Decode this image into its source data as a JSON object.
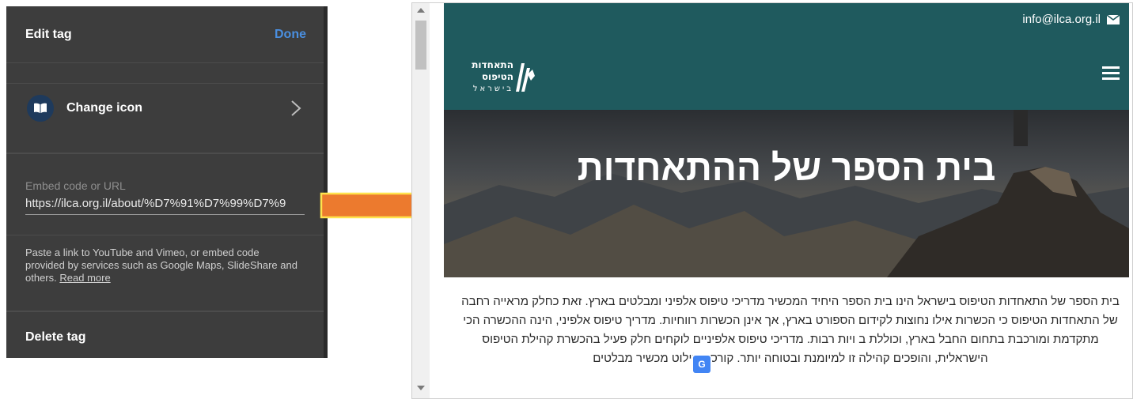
{
  "editor": {
    "header_title": "Edit tag",
    "done_label": "Done",
    "change_icon_label": "Change icon",
    "embed_label": "Embed code or URL",
    "embed_value": "https://ilca.org.il/about/%D7%91%D7%99%D7%9",
    "help_text": "Paste a link to YouTube and Vimeo, or embed code provided by services such as Google Maps, SlideShare and others.",
    "read_more": "Read more",
    "delete_label": "Delete tag",
    "accent_color": "#4a8fe0"
  },
  "site": {
    "email": "info@ilca.org.il",
    "brand_color": "#1f5a5e",
    "logo_lines": [
      "התאחדות",
      "הטיפוס",
      "בישראל"
    ],
    "hero_title": "בית הספר של ההתאחדות",
    "body_text": "בית הספר של התאחדות הטיפוס בישראל הינו בית הספר היחיד המכשיר מדריכי טיפוס אלפיני ומבלטים בארץ. זאת כחלק מראייה רחבה של התאחדות הטיפוס כי הכשרות אילו נחוצות לקידום הספורט בארץ, אך אינן הכשרות רווחיות. מדריך טיפוס אלפיני, הינה ההכשרה הכי מתקדמת ומורכבת בתחום החבל בארץ, וכוללת ב    ויות רבות. מדריכי טיפוס אלפיניים לוקחים חלק פעיל בהכשרת קהילת הטיפוס הישראלית, והופכים קהילה זו למיומנת ובטוחה יותר. קורס הבילוט מכשיר מבלטים",
    "translate_glyph": "G"
  }
}
